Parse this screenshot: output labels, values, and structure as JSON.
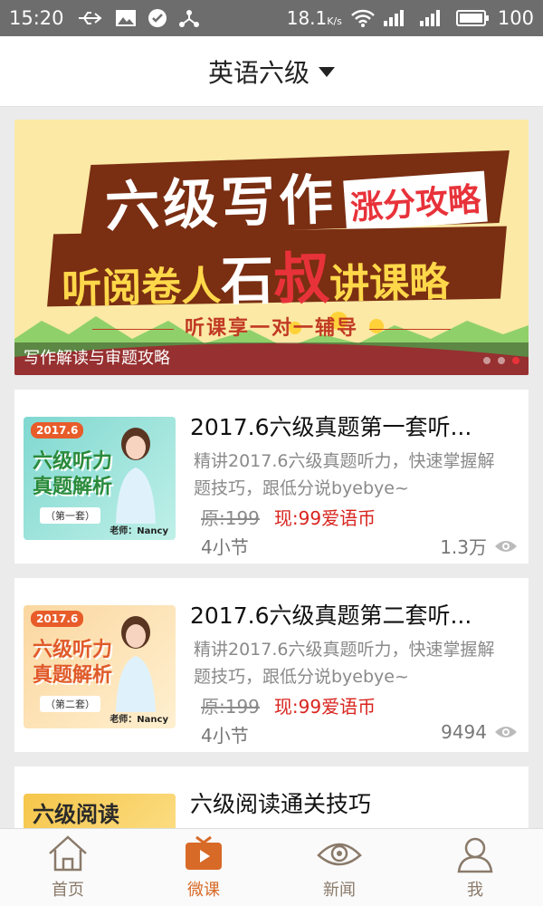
{
  "status": {
    "time": "15:20",
    "speed": "18.1",
    "speed_unit": "K/s",
    "battery": "100"
  },
  "header": {
    "title": "英语六级"
  },
  "banner": {
    "line1": "六级写作",
    "badge": "涨分攻略",
    "line2_a": "听阅卷人",
    "line2_b": "石",
    "line2_c": "叔",
    "line2_d": "讲课略",
    "line3": "听课享一对一辅导",
    "caption": "写作解读与审题攻略"
  },
  "courses": [
    {
      "title": "2017.6六级真题第一套听...",
      "desc": "精讲2017.6六级真题听力，快速掌握解题技巧，跟低分说byebye~",
      "orig_price": "原:199",
      "price": "现:99爱语币",
      "lessons": "4小节",
      "views": "1.3万",
      "thumb": {
        "tag": "2017.6",
        "title": "六级听力真题解析",
        "vol": "（第一套）",
        "teacher": "老师：Nancy"
      }
    },
    {
      "title": "2017.6六级真题第二套听...",
      "desc": "精讲2017.6六级真题听力，快速掌握解题技巧，跟低分说byebye~",
      "orig_price": "原:199",
      "price": "现:99爱语币",
      "lessons": "4小节",
      "views": "9494",
      "thumb": {
        "tag": "2017.6",
        "title": "六级听力真题解析",
        "vol": "（第二套）",
        "teacher": "老师：Nancy"
      }
    },
    {
      "title": "六级阅读通关技巧",
      "thumb": {
        "title": "六级阅读"
      }
    }
  ],
  "nav": [
    {
      "label": "首页",
      "icon": "home-icon"
    },
    {
      "label": "微课",
      "icon": "video-icon",
      "active": true
    },
    {
      "label": "新闻",
      "icon": "eye-icon"
    },
    {
      "label": "我",
      "icon": "user-icon"
    }
  ],
  "colors": {
    "accent": "#d86a28",
    "price_red": "#d8241e",
    "statusbar": "#6d6d6d"
  }
}
